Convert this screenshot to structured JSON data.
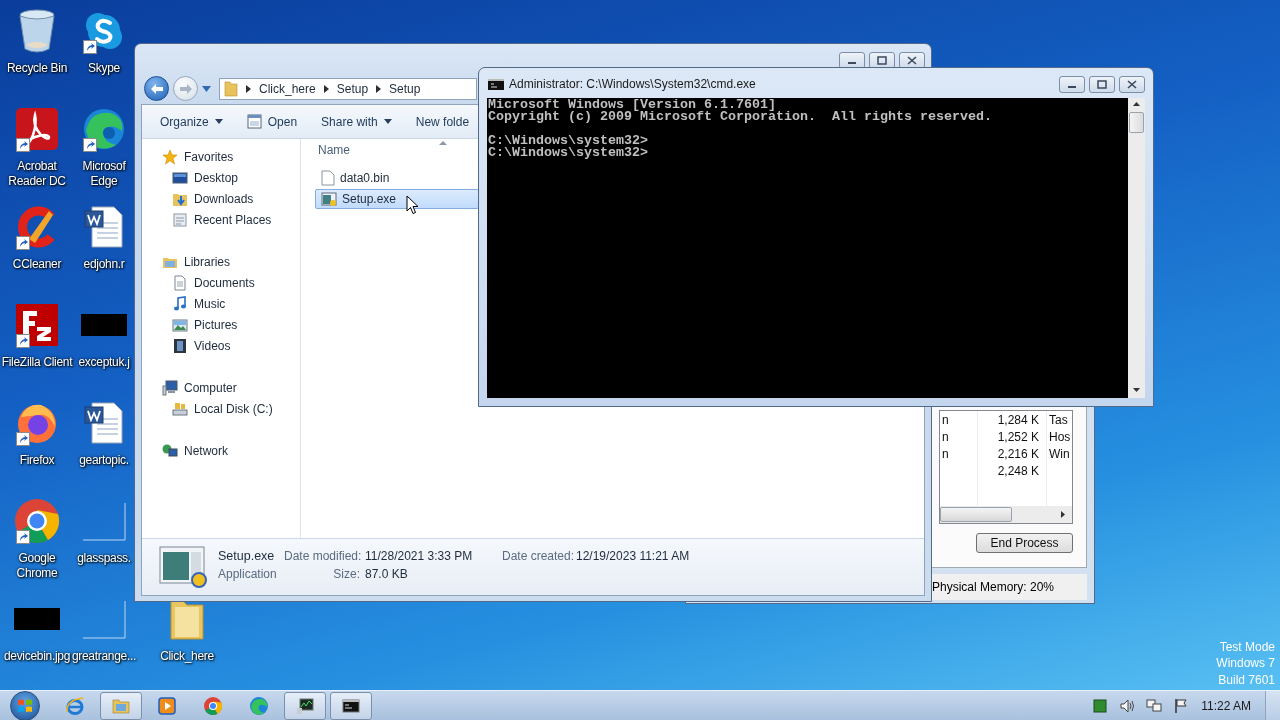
{
  "desktop": {
    "icons": [
      {
        "label": "Recycle Bin",
        "kind": "recycle",
        "shortcut": false
      },
      {
        "label": "Acrobat Reader DC",
        "kind": "acrobat",
        "shortcut": true
      },
      {
        "label": "CCleaner",
        "kind": "ccleaner",
        "shortcut": true
      },
      {
        "label": "FileZilla Client",
        "kind": "filezilla",
        "shortcut": true
      },
      {
        "label": "Firefox",
        "kind": "firefox",
        "shortcut": true
      },
      {
        "label": "Google Chrome",
        "kind": "chrome",
        "shortcut": true
      },
      {
        "label": "devicebin.jpg",
        "kind": "image",
        "shortcut": false
      },
      {
        "label": "Skype",
        "kind": "skype",
        "shortcut": true
      },
      {
        "label": "Microsof Edge",
        "kind": "edge",
        "shortcut": true
      },
      {
        "label": "edjohn.r",
        "kind": "word",
        "shortcut": false
      },
      {
        "label": "exceptuk.j",
        "kind": "image",
        "shortcut": false
      },
      {
        "label": "geartopic.",
        "kind": "word",
        "shortcut": false
      },
      {
        "label": "glasspass.",
        "kind": "blank",
        "shortcut": false
      },
      {
        "label": "greatrange...",
        "kind": "blank",
        "shortcut": false
      },
      {
        "label": "Click_here",
        "kind": "folder",
        "shortcut": false
      }
    ],
    "test_mode": [
      "Test Mode",
      "Windows 7",
      "Build 7601"
    ]
  },
  "explorer": {
    "breadcrumb": [
      "Click_here",
      "Setup",
      "Setup"
    ],
    "toolbar": [
      {
        "label": "Organize",
        "kind": "menu"
      },
      {
        "label": "Open",
        "kind": "open"
      },
      {
        "label": "Share with",
        "kind": "menu"
      },
      {
        "label": "New folde",
        "kind": "plain"
      }
    ],
    "nav": [
      {
        "label": "Favorites",
        "kind": "favorites",
        "children": [
          {
            "label": "Desktop",
            "kind": "desktop"
          },
          {
            "label": "Downloads",
            "kind": "downloads"
          },
          {
            "label": "Recent Places",
            "kind": "recent"
          }
        ]
      },
      {
        "label": "Libraries",
        "kind": "libraries",
        "children": [
          {
            "label": "Documents",
            "kind": "documents"
          },
          {
            "label": "Music",
            "kind": "music"
          },
          {
            "label": "Pictures",
            "kind": "pictures"
          },
          {
            "label": "Videos",
            "kind": "videos"
          }
        ]
      },
      {
        "label": "Computer",
        "kind": "computer",
        "children": [
          {
            "label": "Local Disk (C:)",
            "kind": "disk"
          }
        ]
      },
      {
        "label": "Network",
        "kind": "network"
      }
    ],
    "column_header": "Name",
    "files": [
      {
        "name": "data0.bin",
        "kind": "file",
        "selected": false
      },
      {
        "name": "Setup.exe",
        "kind": "exe",
        "selected": true
      }
    ],
    "details": {
      "name": "Setup.exe",
      "type": "Application",
      "fields": [
        {
          "label": "Date modified:",
          "value": "11/28/2021 3:33 PM"
        },
        {
          "label": "Size:",
          "value": "87.0 KB"
        }
      ],
      "created_label": "Date created:",
      "created_value": "12/19/2023 11:21 AM"
    }
  },
  "cmd": {
    "title": "Administrator: C:\\Windows\\System32\\cmd.exe",
    "blocks": [
      [
        "Microsoft Windows [Version 6.1.7601]",
        "Copyright (c) 2009 Microsoft Corporation.  All rights reserved."
      ],
      [
        "C:\\Windows\\system32>",
        "C:\\Windows\\system32>"
      ]
    ]
  },
  "task_manager": {
    "rows": [
      {
        "column_1": "n",
        "column_2": "1,284 K",
        "column_3": "Tas"
      },
      {
        "column_1": "n",
        "column_2": "1,252 K",
        "column_3": "Hos"
      },
      {
        "column_1": "n",
        "column_2": "2,216 K",
        "column_3": "Win"
      },
      {
        "column_2": "2,248 K"
      }
    ],
    "button": "End Process",
    "status": "Physical Memory: 20%"
  },
  "taskbar": {
    "items": [
      {
        "kind": "ie",
        "active": false
      },
      {
        "kind": "explorer",
        "active": true
      },
      {
        "kind": "media",
        "active": false
      },
      {
        "kind": "chrome",
        "active": false
      },
      {
        "kind": "edge",
        "active": false
      },
      {
        "kind": "taskmgr",
        "active": true
      },
      {
        "kind": "cmd",
        "active": true
      }
    ],
    "clock": "11:22 AM"
  }
}
